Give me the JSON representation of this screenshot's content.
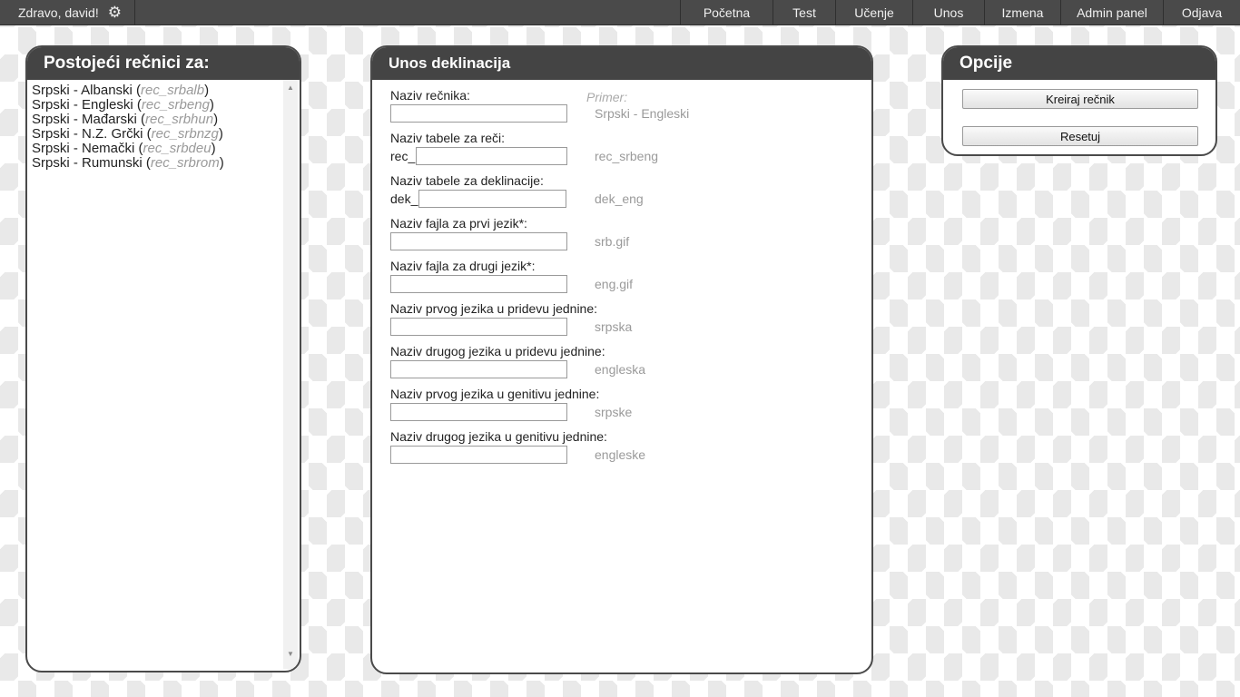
{
  "topbar": {
    "greeting": "Zdravo, david!",
    "settings_icon": "gear-icon",
    "nav": [
      "Početna",
      "Test",
      "Učenje",
      "Unos",
      "Izmena",
      "Admin panel",
      "Odjava"
    ]
  },
  "left_panel": {
    "title": "Postojeći rečnici za:",
    "dictionaries": [
      {
        "name": "Srpski - Albanski",
        "code": "rec_srbalb"
      },
      {
        "name": "Srpski - Engleski",
        "code": "rec_srbeng"
      },
      {
        "name": "Srpski - Mađarski",
        "code": "rec_srbhun"
      },
      {
        "name": "Srpski - N.Z. Grčki",
        "code": "rec_srbnzg"
      },
      {
        "name": "Srpski - Nemački",
        "code": "rec_srbdeu"
      },
      {
        "name": "Srpski - Rumunski",
        "code": "rec_srbrom"
      }
    ],
    "scroll_up_icon": "triangle-up-icon",
    "scroll_down_icon": "triangle-down-icon"
  },
  "center_panel": {
    "title": "Unos deklinacija",
    "example_label": "Primer:",
    "fields": [
      {
        "label": "Naziv rečnika:",
        "prefix": "",
        "value": "",
        "example": "Srpski - Engleski"
      },
      {
        "label": "Naziv tabele za reči:",
        "prefix": "rec_",
        "value": "",
        "example": "rec_srbeng"
      },
      {
        "label": "Naziv tabele za deklinacije:",
        "prefix": "dek_",
        "value": "",
        "example": "dek_eng"
      },
      {
        "label": "Naziv fajla za prvi jezik*:",
        "prefix": "",
        "value": "",
        "example": "srb.gif"
      },
      {
        "label": "Naziv fajla za drugi jezik*:",
        "prefix": "",
        "value": "",
        "example": "eng.gif"
      },
      {
        "label": "Naziv prvog jezika u pridevu jednine:",
        "prefix": "",
        "value": "",
        "example": "srpska"
      },
      {
        "label": "Naziv drugog jezika u pridevu jednine:",
        "prefix": "",
        "value": "",
        "example": "engleska"
      },
      {
        "label": "Naziv prvog jezika u genitivu jednine:",
        "prefix": "",
        "value": "",
        "example": "srpske"
      },
      {
        "label": "Naziv drugog jezika u genitivu jednine:",
        "prefix": "",
        "value": "",
        "example": "engleske"
      }
    ]
  },
  "right_panel": {
    "title": "Opcije",
    "buttons": [
      "Kreiraj rečnik",
      "Resetuj"
    ]
  }
}
